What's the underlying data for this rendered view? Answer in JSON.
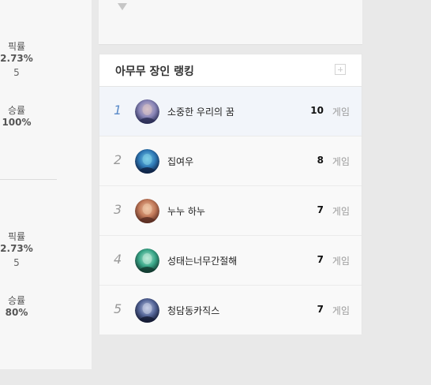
{
  "left_stats": [
    {
      "pick_label": "픽률",
      "pick_rate": "2.73%",
      "pick_count": "5",
      "win_label": "승률",
      "win_rate": "100%"
    },
    {
      "pick_label": "픽률",
      "pick_rate": "2.73%",
      "pick_count": "5",
      "win_label": "승률",
      "win_rate": "80%"
    }
  ],
  "ranking": {
    "title": "아무무 장인 랭킹",
    "unit": "게임",
    "players": [
      {
        "rank": "1",
        "name": "소중한 우리의 꿈",
        "games": "10",
        "avatar_colors": [
          "#2a2d55",
          "#8a86b8",
          "#d8c2c8"
        ]
      },
      {
        "rank": "2",
        "name": "집여우",
        "games": "8",
        "avatar_colors": [
          "#0f2346",
          "#2f7bb8",
          "#7fd0e8"
        ]
      },
      {
        "rank": "3",
        "name": "누누 하누",
        "games": "7",
        "avatar_colors": [
          "#5a2d22",
          "#c27a5a",
          "#f0c8a8"
        ]
      },
      {
        "rank": "4",
        "name": "성태는너무간절해",
        "games": "7",
        "avatar_colors": [
          "#123a30",
          "#3aa88a",
          "#bdebd8"
        ]
      },
      {
        "rank": "5",
        "name": "청담동카직스",
        "games": "7",
        "avatar_colors": [
          "#141a33",
          "#556699",
          "#c8d0e8"
        ]
      }
    ]
  }
}
